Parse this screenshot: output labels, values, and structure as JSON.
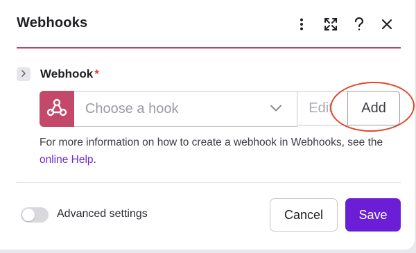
{
  "dialog": {
    "title": "Webhooks",
    "accent_color": "#c3426a"
  },
  "header_icons": [
    "more-vertical-icon",
    "expand-icon",
    "help-icon",
    "close-icon"
  ],
  "field": {
    "label": "Webhook",
    "required_marker": "*",
    "app_icon": "webhooks-icon",
    "app_color": "#c4486a",
    "select_placeholder": "Choose a hook",
    "edit_label": "Edit",
    "add_label": "Add"
  },
  "help": {
    "text_before": "For more information on how to create a webhook in Webhooks, see the ",
    "link_text": "online Help",
    "text_after": "."
  },
  "footer": {
    "advanced_label": "Advanced settings",
    "advanced_enabled": false,
    "cancel_label": "Cancel",
    "save_label": "Save",
    "save_color": "#6a1fd6"
  }
}
